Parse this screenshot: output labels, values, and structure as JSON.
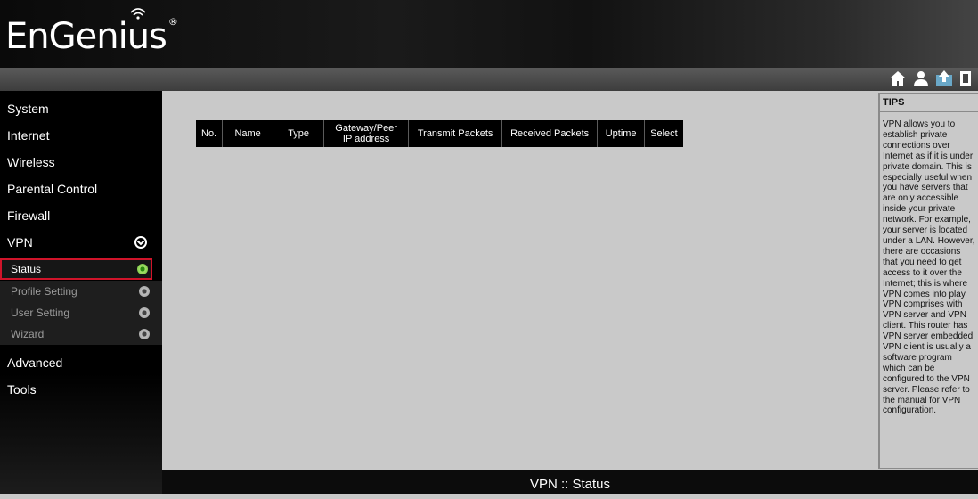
{
  "brand": {
    "logo_text": "EnGenius",
    "reg_mark": "®"
  },
  "top_icons": [
    "home-icon",
    "user-icon",
    "network-upload-icon",
    "logout-icon"
  ],
  "sidebar": {
    "items": [
      {
        "label": "System"
      },
      {
        "label": "Internet"
      },
      {
        "label": "Wireless"
      },
      {
        "label": "Parental Control"
      },
      {
        "label": "Firewall"
      },
      {
        "label": "VPN"
      },
      {
        "label": "Advanced"
      },
      {
        "label": "Tools"
      }
    ],
    "vpn_submenu": [
      {
        "label": "Status",
        "active": true
      },
      {
        "label": "Profile Setting",
        "active": false
      },
      {
        "label": "User Setting",
        "active": false
      },
      {
        "label": "Wizard",
        "active": false
      }
    ]
  },
  "table": {
    "headers": [
      "No.",
      "Name",
      "Type",
      "Gateway/Peer IP address",
      "Transmit Packets",
      "Received Packets",
      "Uptime",
      "Select"
    ]
  },
  "tips": {
    "title": "TIPS",
    "text": "VPN allows you to\nestablish private\nconnections over\nInternet as if it is under\nprivate domain. This is\nespecially useful when\nyou have servers that\nare only accessible\ninside your private\nnetwork. For example,\nyour server is located\nunder a LAN. However,\nthere are occasions\nthat you need to get\naccess to it over the\nInternet; this is where\nVPN comes into play.\nVPN comprises with\nVPN server and VPN\nclient. This router has\nVPN server embedded.\nVPN client is usually a\nsoftware program\nwhich can be\nconfigured to the VPN\nserver. Please refer to\nthe manual for VPN\nconfiguration."
  },
  "footer": {
    "page_title": "VPN :: Status"
  },
  "colors": {
    "accent_red": "#d0142a",
    "active_dot": "#6cbf3a"
  }
}
